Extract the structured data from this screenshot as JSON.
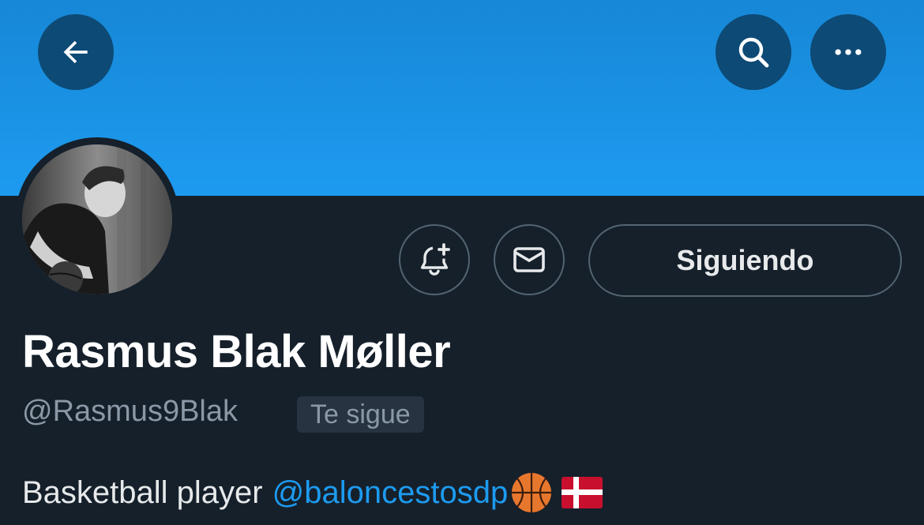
{
  "profile": {
    "display_name": "Rasmus Blak Møller",
    "handle": "@Rasmus9Blak",
    "follows_you_badge": "Te sigue",
    "bio_text": "Basketball player",
    "bio_mention": "@baloncestosdp",
    "bio_emojis": [
      "basketball-emoji",
      "denmark-flag-emoji"
    ]
  },
  "actions": {
    "follow_label": "Siguiendo"
  },
  "icons": {
    "back": "back-arrow-icon",
    "search": "search-icon",
    "more": "more-dots-icon",
    "notify": "bell-plus-icon",
    "message": "envelope-icon"
  },
  "colors": {
    "banner": "#1d9bf0",
    "background": "#15202b",
    "accent_link": "#1d9bf0",
    "muted_text": "#8b98a5"
  }
}
